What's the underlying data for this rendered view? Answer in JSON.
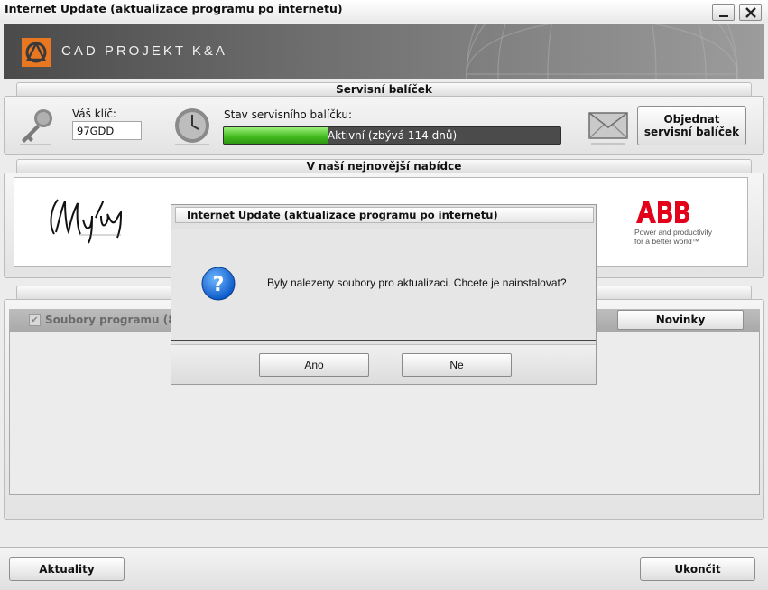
{
  "window": {
    "title": "Internet Update (aktualizace programu po internetu)"
  },
  "banner": {
    "company": "CAD PROJEKT K&A"
  },
  "service": {
    "header": "Servisní balíček",
    "key_label": "Váš klíč:",
    "key_value": "97GDD",
    "status_label": "Stav servisního balíčku:",
    "status_text": "Aktivní  (zbývá 114 dnů)",
    "progress_fraction": 0.31,
    "order_button": "Objednat servisní balíček"
  },
  "offer": {
    "header": "V naší nejnovější nabídce",
    "brand_right": "ABB",
    "brand_right_tagline_1": "Power and productivity",
    "brand_right_tagline_2": "for a better world™"
  },
  "files": {
    "label": "Soubory programu (8",
    "news_button": "Novinky"
  },
  "bottom": {
    "left_button": "Aktuality",
    "right_button": "Ukončit"
  },
  "dialog": {
    "title": "Internet Update (aktualizace programu po internetu)",
    "message": "Byly nalezeny soubory pro aktualizaci. Chcete je nainstalovat?",
    "yes_button": "Ano",
    "no_button": "Ne"
  },
  "colors": {
    "progress_green": "#3fb81d",
    "abb_red": "#e2001a",
    "logo_orange": "#e87722"
  }
}
